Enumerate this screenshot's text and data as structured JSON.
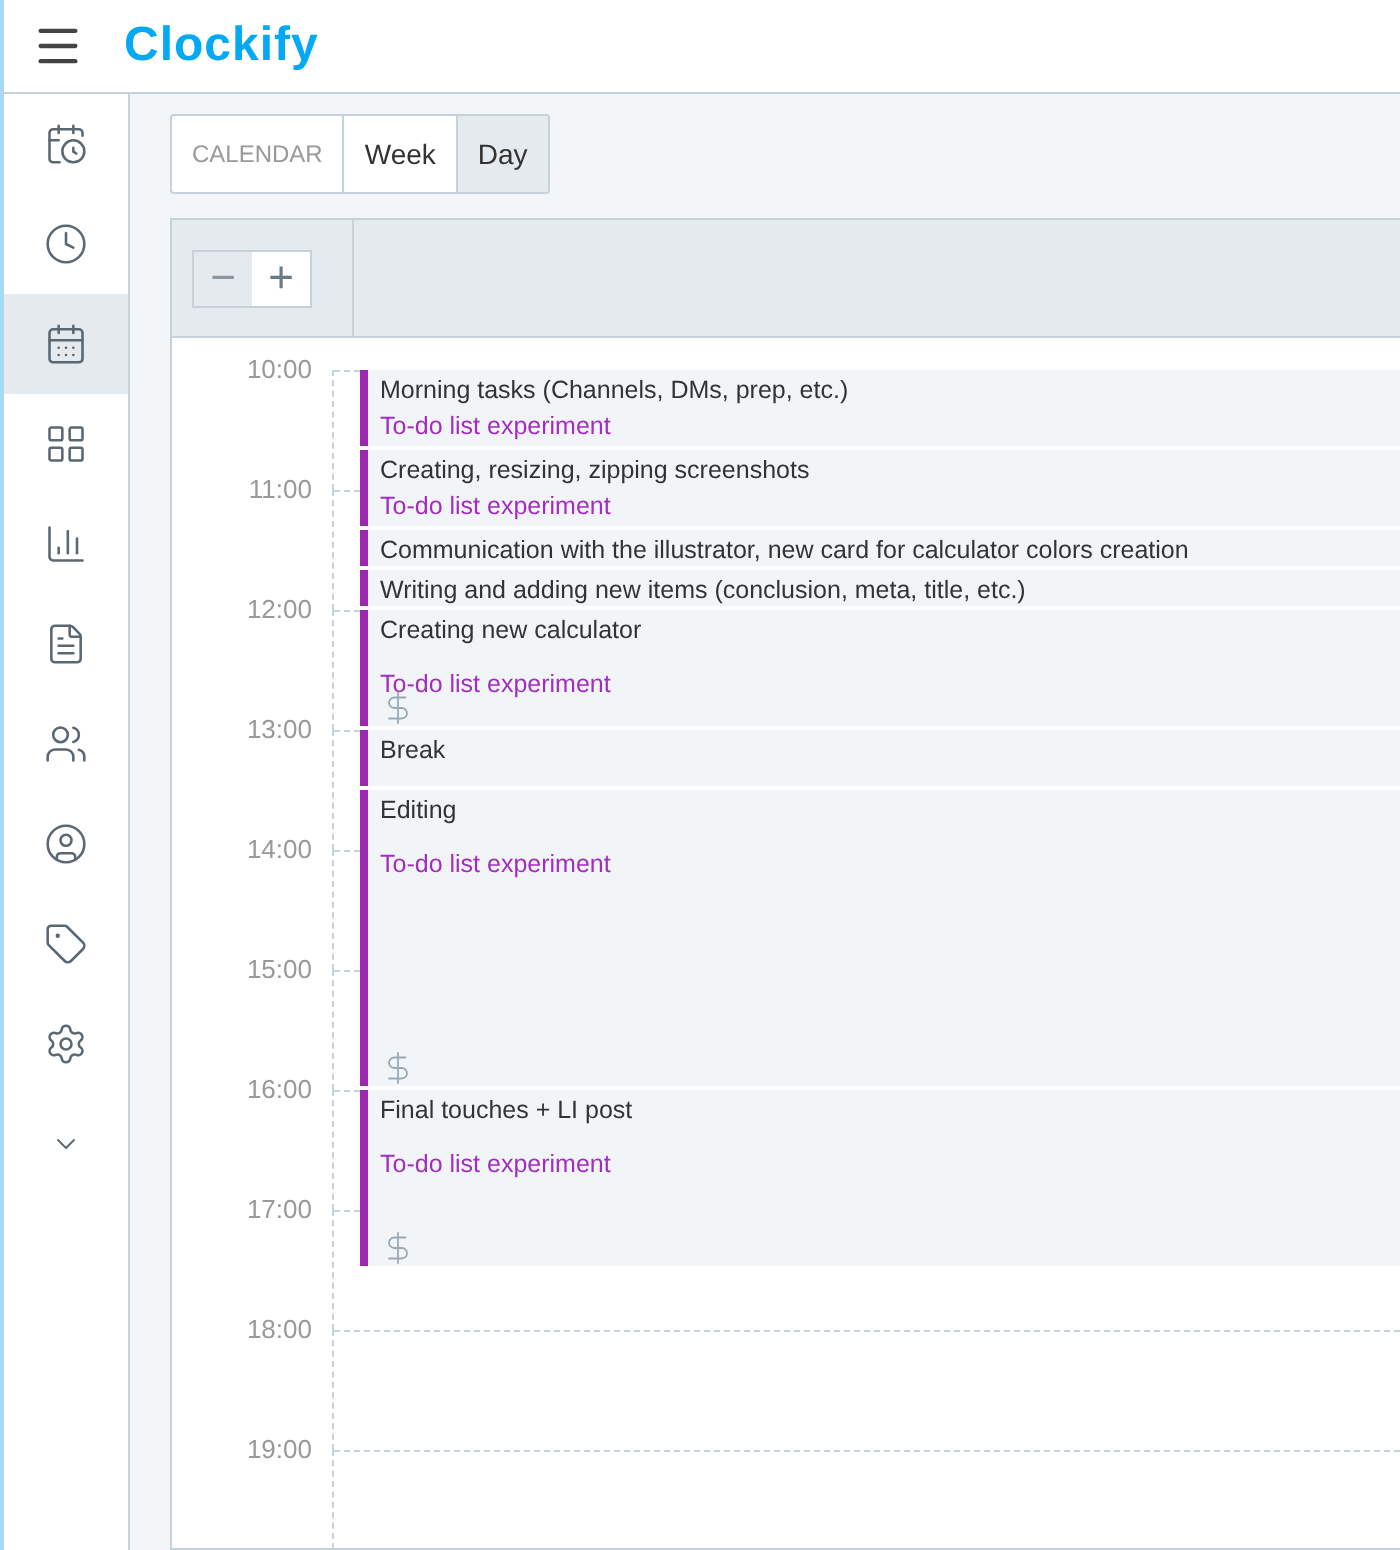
{
  "header": {
    "logo": "Clockify"
  },
  "sidebar": {
    "items": [
      {
        "selected": false
      },
      {
        "selected": false
      },
      {
        "selected": true
      },
      {
        "selected": false
      },
      {
        "selected": false
      },
      {
        "selected": false
      },
      {
        "selected": false
      },
      {
        "selected": false
      },
      {
        "selected": false
      },
      {
        "selected": false
      },
      {
        "selected": false
      }
    ]
  },
  "view_switch": {
    "label": "CALENDAR",
    "tabs": [
      {
        "label": "Week",
        "selected": false
      },
      {
        "label": "Day",
        "selected": true
      }
    ]
  },
  "zoom": [
    {
      "label": "−",
      "disabled": true
    },
    {
      "label": "+",
      "disabled": false
    }
  ],
  "hours": [
    "10:00",
    "11:00",
    "12:00",
    "13:00",
    "14:00",
    "15:00",
    "16:00",
    "17:00",
    "18:00",
    "19:00"
  ],
  "entries": [
    {
      "description": "Morning tasks (Channels, DMs, prep, etc.)",
      "project": "To-do list experiment",
      "billable": false
    },
    {
      "description": "Creating, resizing, zipping screenshots",
      "project": "To-do list experiment",
      "billable": false
    },
    {
      "description": "Communication with the illustrator, new card for calculator colors creation",
      "billable": false
    },
    {
      "description": "Writing and adding new items (conclusion, meta, title, etc.)",
      "billable": false
    },
    {
      "description": "Creating new calculator",
      "project": "To-do list experiment",
      "billable": true
    },
    {
      "description": "Break",
      "billable": false
    },
    {
      "description": "Editing",
      "project": "To-do list experiment",
      "billable": true
    },
    {
      "description": "Final touches + LI post",
      "project": "To-do list experiment",
      "billable": true
    }
  ]
}
